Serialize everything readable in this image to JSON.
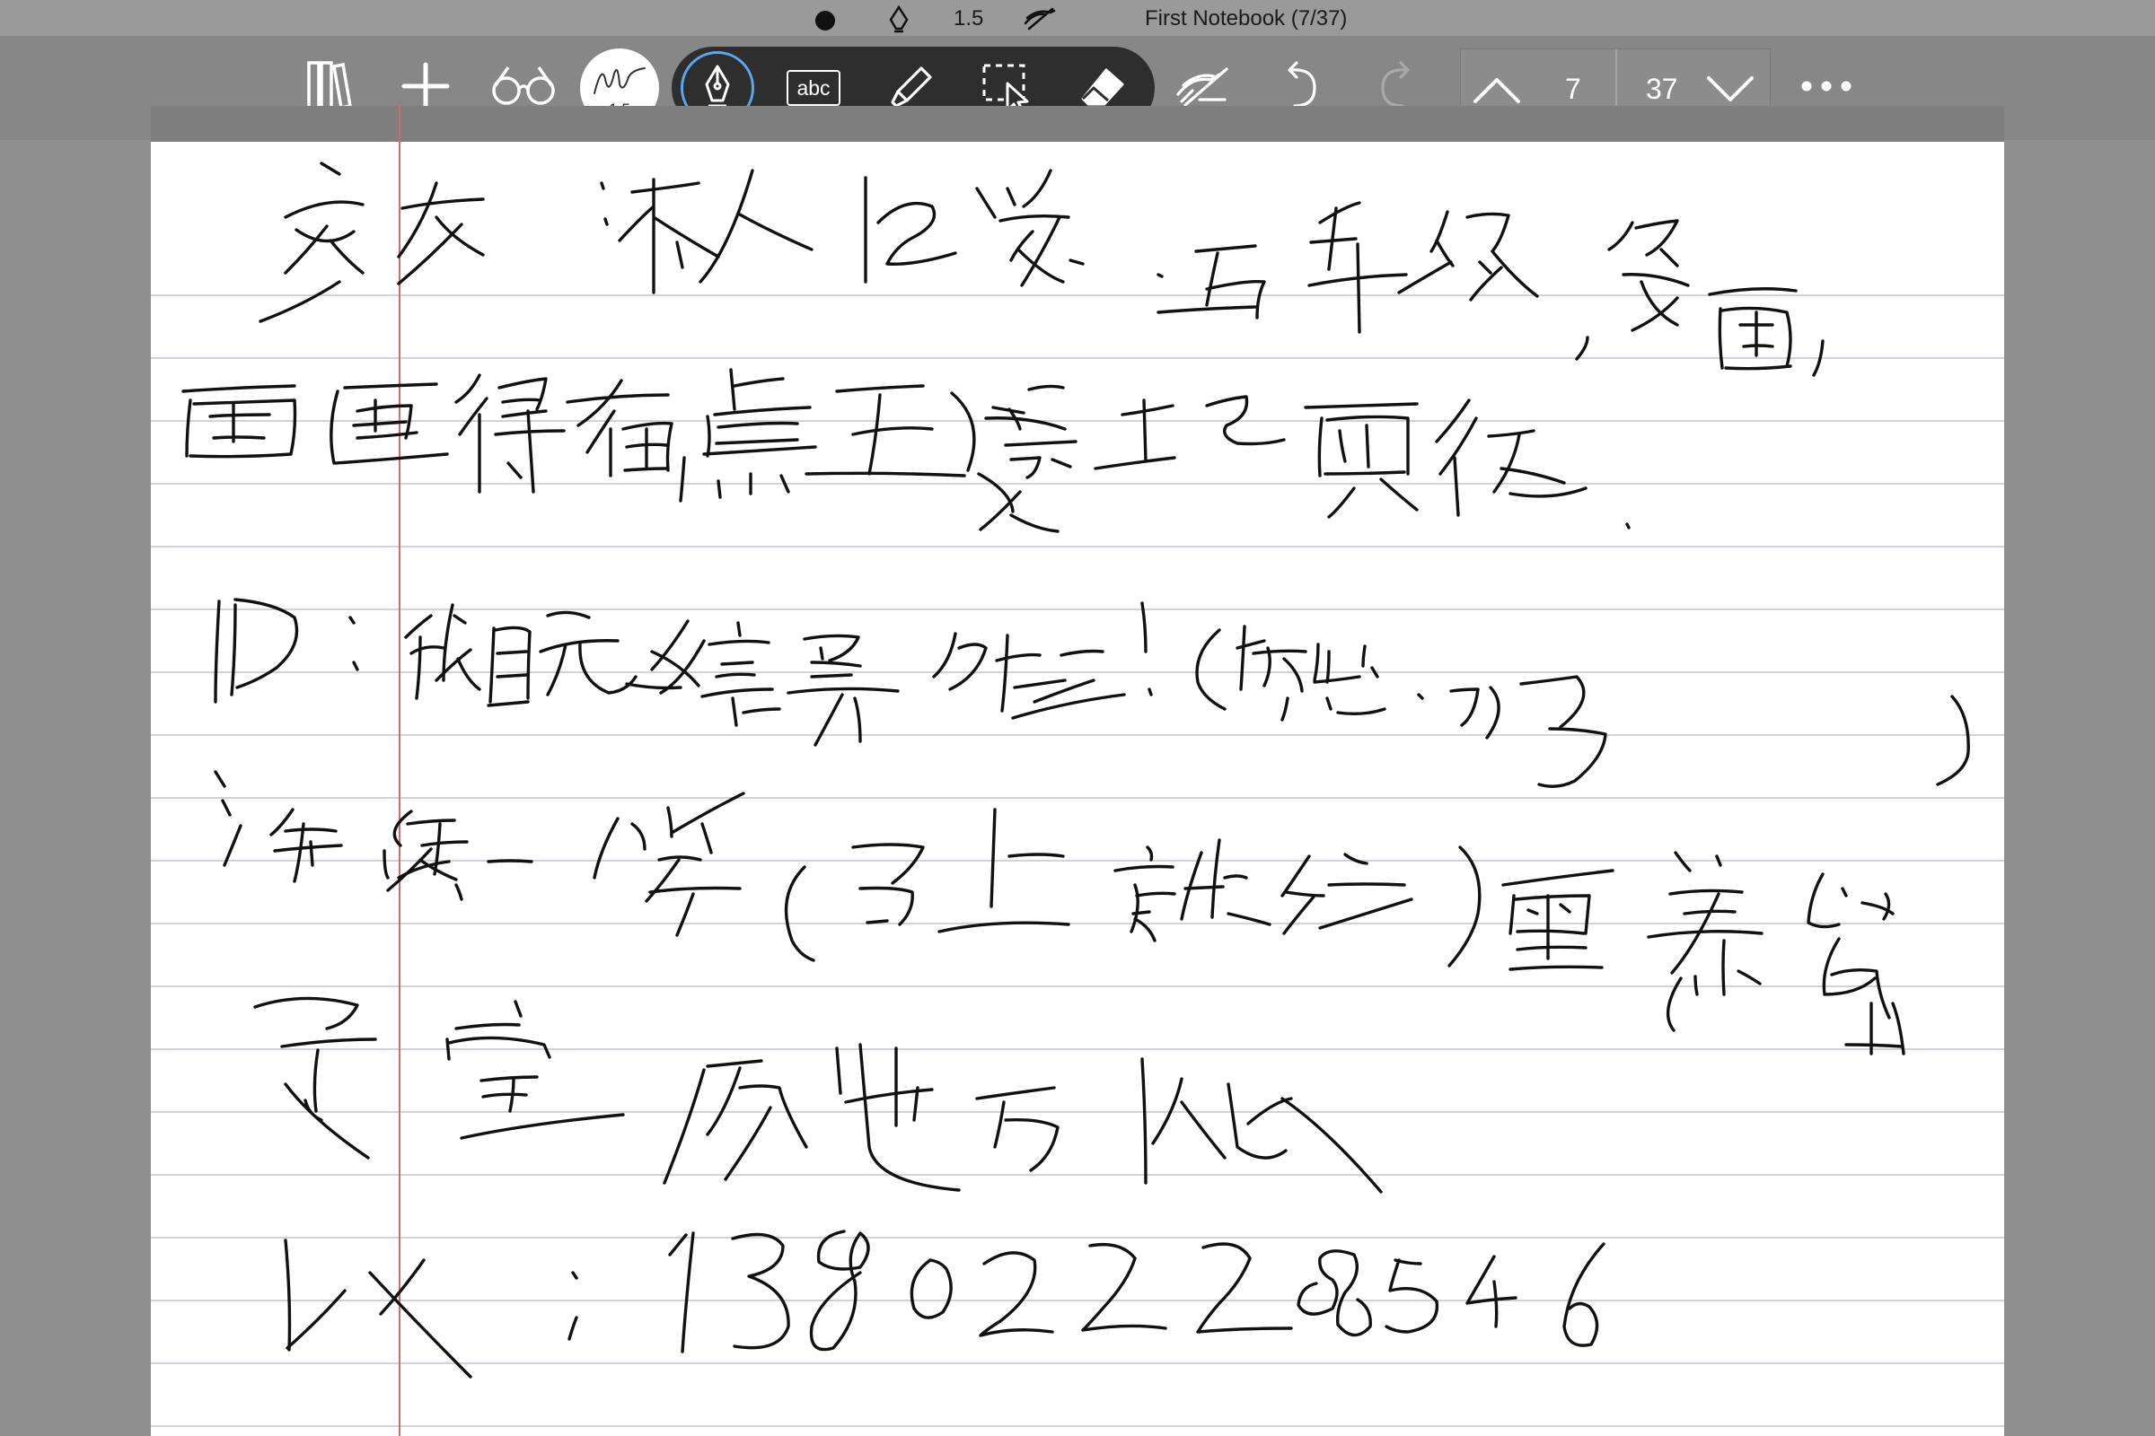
{
  "status": {
    "stroke_size": "1.5",
    "notebook_title": "First Notebook (7/37)"
  },
  "toolbar": {
    "pen_preview_size": "1.5",
    "text_tool_label": "abc",
    "icons": {
      "library": "library-icon",
      "add": "plus-icon",
      "view": "glasses-icon",
      "pen": "fountain-pen-icon",
      "text": "text-box-icon",
      "highlighter": "highlighter-icon",
      "lasso": "lasso-select-icon",
      "eraser": "eraser-icon",
      "hide_ink": "hide-ink-icon",
      "undo": "undo-icon",
      "redo": "redo-icon",
      "page_up": "chevron-up-icon",
      "page_down": "chevron-down-icon",
      "more": "more-dots-icon"
    }
  },
  "pager": {
    "current_page": "7",
    "total_pages": "37"
  },
  "colors": {
    "active_tool_ring": "#5aa7f0",
    "margin_line": "#d56a6a",
    "rule_line": "#cfd3da",
    "ink": "#111111"
  },
  "page": {
    "handwriting_icon": "handwritten-ink-strokes"
  }
}
